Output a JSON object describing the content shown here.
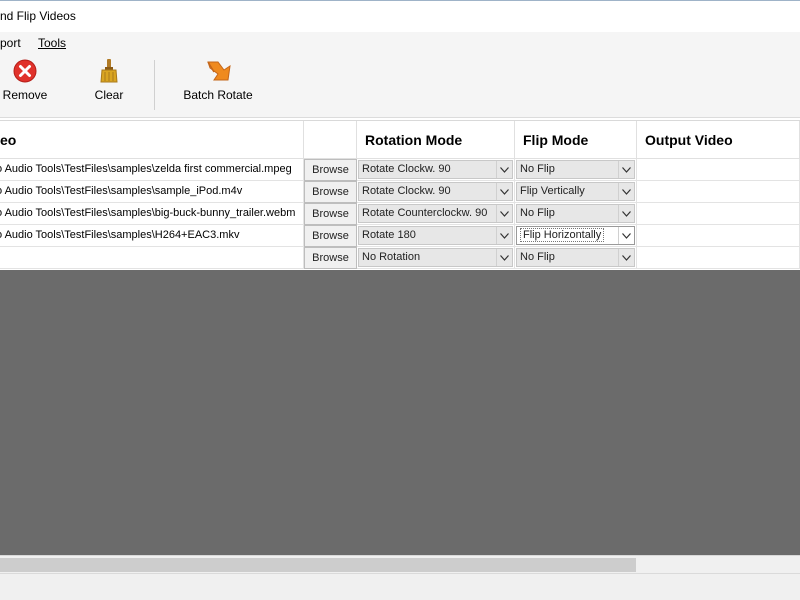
{
  "window": {
    "title": "nd Flip Videos"
  },
  "menu": {
    "items": [
      "port",
      "Tools"
    ]
  },
  "toolbar": {
    "remove_label": "Remove",
    "clear_label": "Clear",
    "batch_rotate_label": "Batch Rotate"
  },
  "grid": {
    "headers": {
      "input_video": "eo",
      "rotation_mode": "Rotation Mode",
      "flip_mode": "Flip Mode",
      "output_video": "Output Video"
    },
    "browse_label": "Browse",
    "rows": [
      {
        "path": "o Audio Tools\\TestFiles\\samples\\zelda first commercial.mpeg",
        "rotation": "Rotate Clockw. 90",
        "flip": "No Flip",
        "output": ""
      },
      {
        "path": "o Audio Tools\\TestFiles\\samples\\sample_iPod.m4v",
        "rotation": "Rotate Clockw. 90",
        "flip": "Flip Vertically",
        "output": ""
      },
      {
        "path": "o Audio Tools\\TestFiles\\samples\\big-buck-bunny_trailer.webm",
        "rotation": "Rotate Counterclockw. 90",
        "flip": "No Flip",
        "output": ""
      },
      {
        "path": "o Audio Tools\\TestFiles\\samples\\H264+EAC3.mkv",
        "rotation": "Rotate 180",
        "flip": "Flip Horizontally",
        "output": ""
      },
      {
        "path": "",
        "rotation": "No Rotation",
        "flip": "No Flip",
        "output": ""
      }
    ]
  },
  "icons": {
    "remove": "remove-x-icon",
    "clear": "broom-icon",
    "batch_rotate": "batch-rotate-icon",
    "dropdown": "chevron-down-icon"
  },
  "colors": {
    "remove_red": "#e0322b",
    "clear_gold": "#d9a521",
    "rotate_orange": "#ef8a1f",
    "empty_area": "#6b6b6b"
  }
}
